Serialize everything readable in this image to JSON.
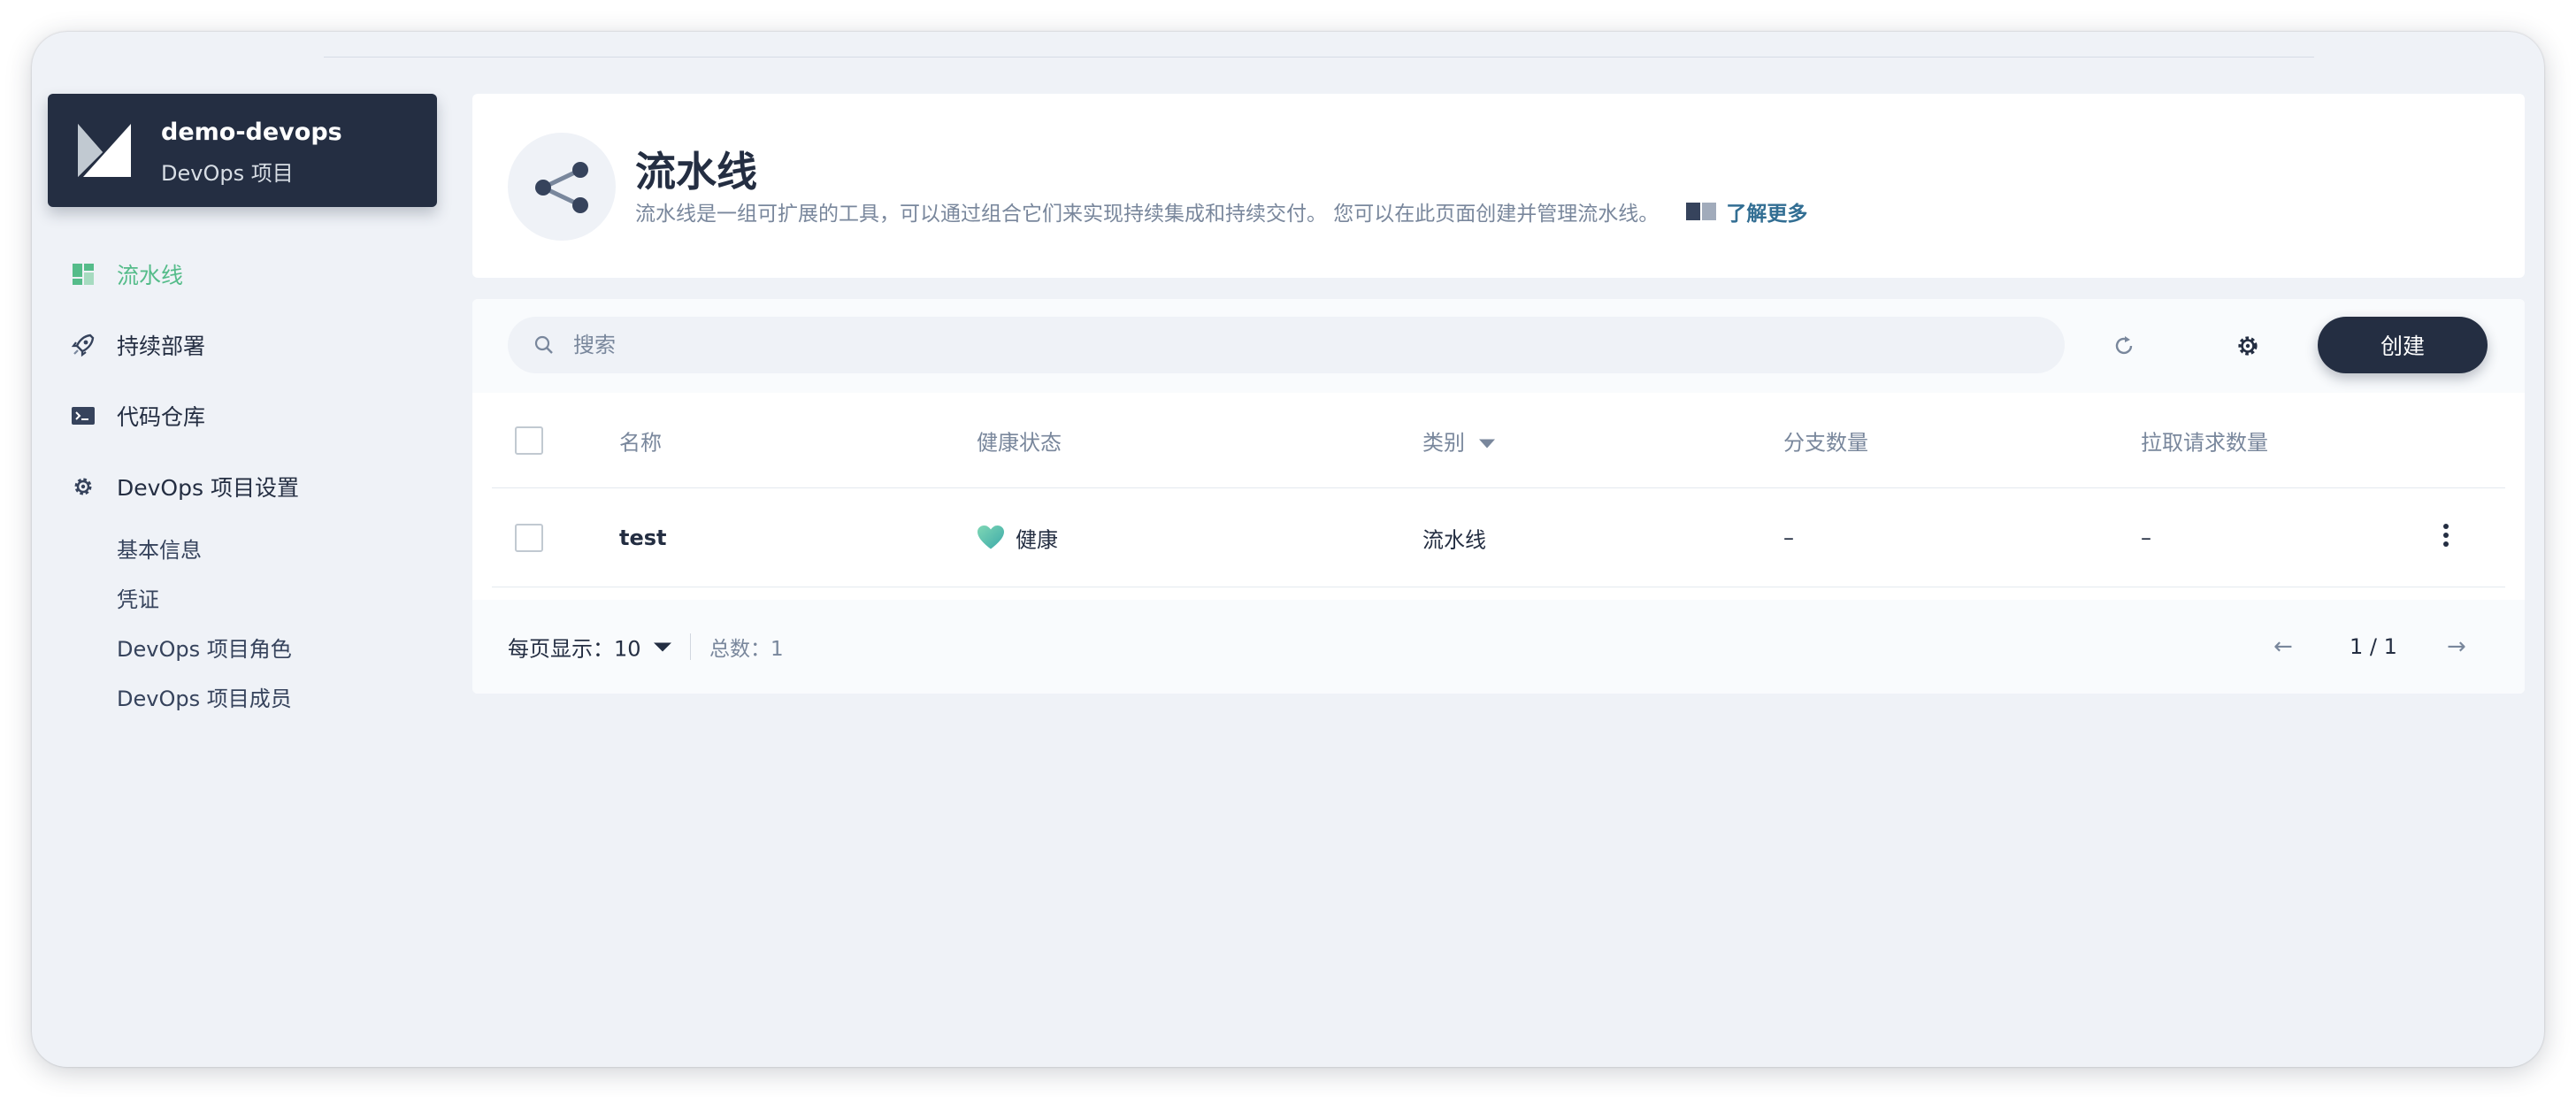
{
  "project": {
    "name": "demo-devops",
    "subtitle": "DevOps 项目"
  },
  "sidebar": {
    "items": [
      {
        "label": "流水线",
        "icon": "pipeline-grid-icon",
        "active": true
      },
      {
        "label": "持续部署",
        "icon": "rocket-icon",
        "active": false
      },
      {
        "label": "代码仓库",
        "icon": "terminal-icon",
        "active": false
      },
      {
        "label": "DevOps 项目设置",
        "icon": "gear-icon",
        "active": false
      }
    ],
    "settings_sub": [
      "基本信息",
      "凭证",
      "DevOps 项目角色",
      "DevOps 项目成员"
    ]
  },
  "header": {
    "title": "流水线",
    "description": "流水线是一组可扩展的工具，可以通过组合它们来实现持续集成和持续交付。 您可以在此页面创建并管理流水线。",
    "learn_more": "了解更多"
  },
  "toolbar": {
    "search_placeholder": "搜索",
    "create_label": "创建"
  },
  "table": {
    "columns": [
      "名称",
      "健康状态",
      "类别",
      "分支数量",
      "拉取请求数量"
    ],
    "rows": [
      {
        "name": "test",
        "health": "健康",
        "type": "流水线",
        "branches": "–",
        "pull_requests": "–"
      }
    ]
  },
  "pagination": {
    "per_page": "每页显示：10",
    "total": "总数：1",
    "page": "1 / 1"
  },
  "colors": {
    "accent": "#55bc8a",
    "dark": "#242e42",
    "muted": "#79879c",
    "bg": "#eff2f7"
  }
}
